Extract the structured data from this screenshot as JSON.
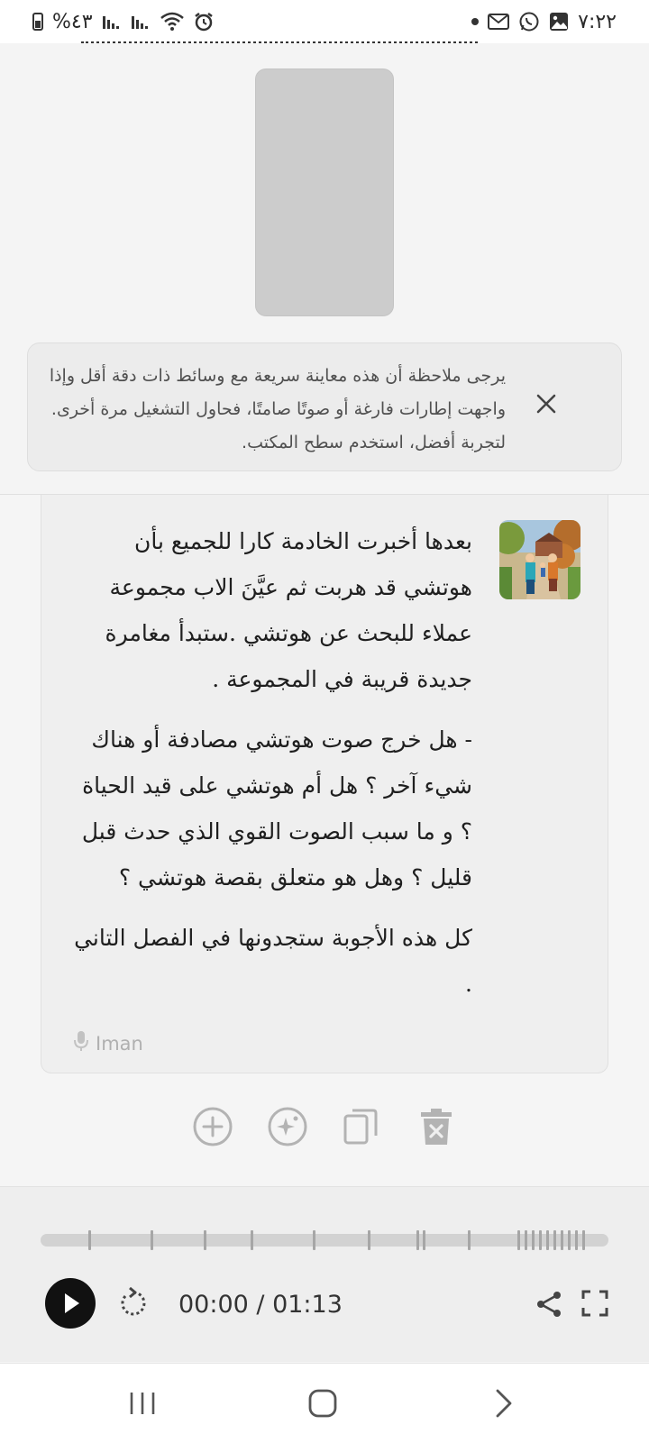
{
  "status_bar": {
    "time": "٧:٢٢",
    "battery": "%٤٣"
  },
  "notice": {
    "text": "يرجى ملاحظة أن هذه معاينة سريعة مع وسائط ذات دقة أقل وإذا واجهت إطارات فارغة أو صوتًا صامتًا، فحاول التشغيل مرة أخرى. لتجربة أفضل، استخدم سطح المكتب."
  },
  "story": {
    "paragraphs": [
      "بعدها أخبرت الخادمة كارا للجميع بأن هوتشي قد هربت ثم عيَّنَ الاب مجموعة عملاء للبحث عن هوتشي .ستبدأ مغامرة جديدة قريبة في المجموعة .",
      "- هل خرج صوت هوتشي مصادفة أو هناك شيء آخر ؟ هل أم هوتشي على قيد الحياة ؟ و ما سبب الصوت القوي الذي حدث قبل قليل ؟ وهل هو متعلق بقصة هوتشي ؟",
      "كل هذه الأجوبة ستجدونها في الفصل التاني ."
    ],
    "author": "Iman",
    "author_icon": "microphone-icon"
  },
  "actions": [
    "add-circle-icon",
    "magic-sparkle-icon",
    "copy-icon",
    "delete-icon"
  ],
  "player": {
    "time_display": "00:00 / 01:13",
    "progress": 0,
    "accent": "#111111"
  },
  "nav": [
    "recent-apps-icon",
    "home-icon",
    "back-icon"
  ]
}
